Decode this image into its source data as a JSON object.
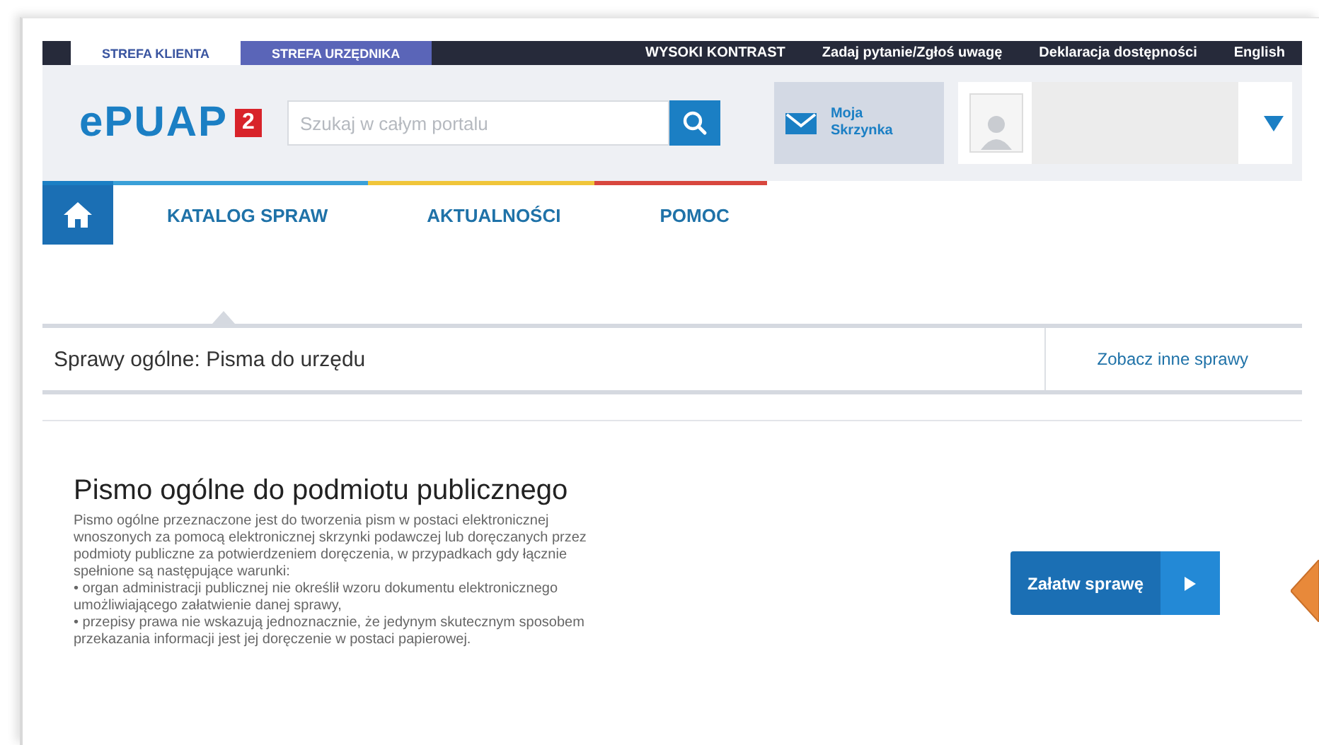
{
  "top_bar": {
    "zones": [
      {
        "label": "STREFA KLIENTA",
        "selected": true
      },
      {
        "label": "STREFA URZĘDNIKA",
        "selected": false
      }
    ],
    "links": [
      "WYSOKI KONTRAST",
      "Zadaj pytanie/Zgłoś uwagę",
      "Deklaracja dostępności",
      "English"
    ]
  },
  "header": {
    "logo": {
      "text": "ePUAP",
      "badge": "2"
    },
    "search": {
      "placeholder": "Szukaj w całym portalu"
    },
    "mailbox": {
      "line1": "Moja",
      "line2": "Skrzynka"
    }
  },
  "nav": {
    "items": [
      "KATALOG SPRAW",
      "AKTUALNOŚCI",
      "POMOC"
    ]
  },
  "breadcrumb": {
    "title": "Sprawy ogólne: Pisma do urzędu",
    "link": "Zobacz inne sprawy"
  },
  "service": {
    "title": "Pismo ogólne do podmiotu publicznego",
    "description": "Pismo ogólne przeznaczone jest do tworzenia pism w postaci elektronicznej wnoszonych za pomocą elektronicznej skrzynki podawczej lub doręczanych przez podmioty publiczne za potwierdzeniem doręczenia, w przypadkach gdy łącznie spełnione są następujące warunki:\n• organ administracji publicznej nie określił wzoru dokumentu elektronicznego umożliwiającego załatwienie danej sprawy,\n• przepisy prawa nie wskazują jednoznacznie, że jedynym skutecznym sposobem przekazania informacji jest jej doręczenie w postaci papierowej.",
    "button": "Załatw sprawę"
  }
}
